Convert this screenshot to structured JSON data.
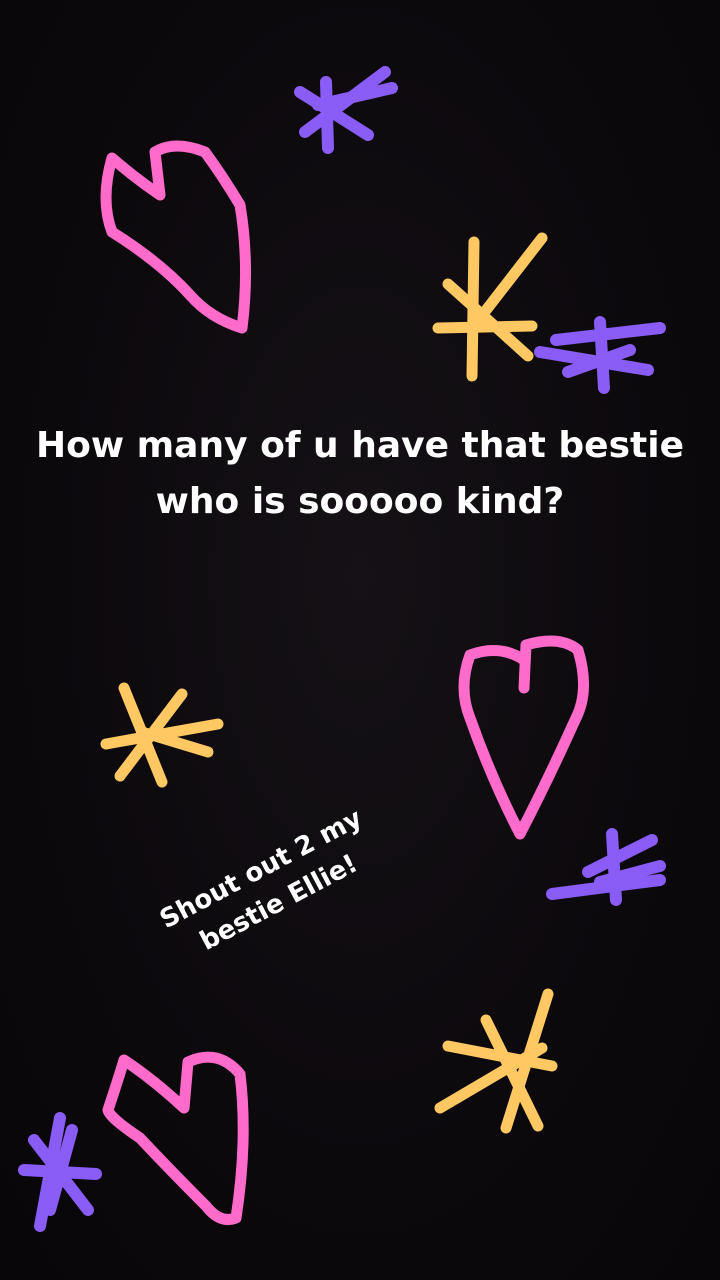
{
  "story": {
    "headline_line1": "How many of u have that bestie",
    "headline_line2": "who is sooooo kind?",
    "sticker_line1": "Shout out 2 my",
    "sticker_line2": "bestie Ellie!"
  },
  "colors": {
    "background": "#0d0a0e",
    "pink": "#ff6bcb",
    "yellow": "#ffc862",
    "purple": "#8a5cf6",
    "text": "#ffffff"
  },
  "doodles": [
    {
      "icon": "heart-doodle-icon",
      "color": "pink"
    },
    {
      "icon": "star-doodle-icon",
      "color": "purple"
    },
    {
      "icon": "star-doodle-icon",
      "color": "yellow"
    },
    {
      "icon": "star-doodle-icon",
      "color": "purple"
    },
    {
      "icon": "star-doodle-icon",
      "color": "yellow"
    },
    {
      "icon": "heart-doodle-icon",
      "color": "pink"
    },
    {
      "icon": "star-doodle-icon",
      "color": "purple"
    },
    {
      "icon": "star-doodle-icon",
      "color": "yellow"
    },
    {
      "icon": "heart-doodle-icon",
      "color": "pink"
    },
    {
      "icon": "star-doodle-icon",
      "color": "purple"
    }
  ]
}
